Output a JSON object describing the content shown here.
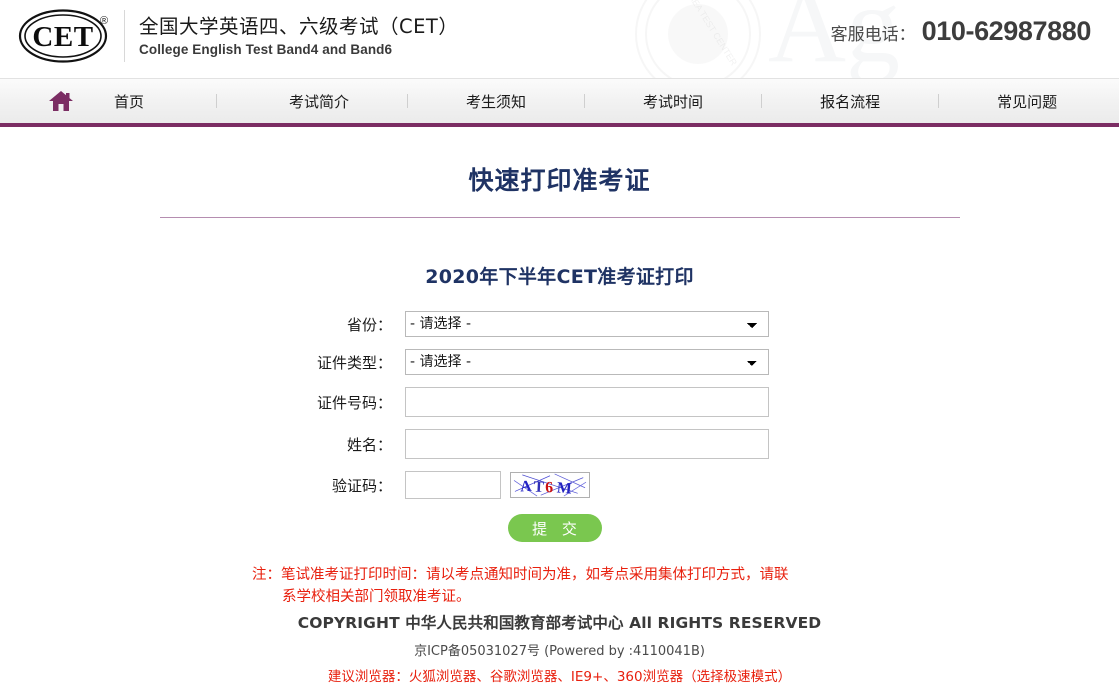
{
  "header": {
    "logo_alt": "CET",
    "logo_mark_text": "CET",
    "logo_registered": "®",
    "title_cn": "全国大学英语四、六级考试（CET）",
    "title_en": "College English Test Band4 and Band6",
    "hotline_label": "客服电话：",
    "hotline_number": "010-62987880"
  },
  "nav": {
    "home_icon": "home-icon",
    "items": [
      {
        "label": "首页"
      },
      {
        "label": "考试简介"
      },
      {
        "label": "考生须知"
      },
      {
        "label": "考试时间"
      },
      {
        "label": "报名流程"
      },
      {
        "label": "常见问题"
      }
    ]
  },
  "main": {
    "page_title": "快速打印准考证",
    "sub_title": "2020年下半年CET准考证打印"
  },
  "form": {
    "province": {
      "label": "省份：",
      "value": "- 请选择 -",
      "options": [
        "- 请选择 -"
      ]
    },
    "id_type": {
      "label": "证件类型：",
      "value": "- 请选择 -",
      "options": [
        "- 请选择 -"
      ]
    },
    "id_number": {
      "label": "证件号码：",
      "value": "",
      "placeholder": ""
    },
    "name": {
      "label": "姓名：",
      "value": "",
      "placeholder": ""
    },
    "captcha": {
      "label": "验证码：",
      "value": "",
      "placeholder": "",
      "image_text": "AT6M",
      "image_alt": "captcha-image"
    },
    "submit_label": "提 交"
  },
  "note": {
    "line1": "注：笔试准考证打印时间：请以考点通知时间为准，如考点采用集体打印方式，请联",
    "line2": "系学校相关部门领取准考证。"
  },
  "footer": {
    "copyright": "COPYRIGHT 中华人民共和国教育部考试中心 All RIGHTS RESERVED",
    "icp": "京ICP备05031027号 (Powered by :4110041B)",
    "browser_note": "建议浏览器：火狐浏览器、谷歌浏览器、IE9+、360浏览器（选择极速模式）"
  },
  "colors": {
    "brand_purple": "#7b2d63",
    "title_navy": "#1f3364",
    "note_red": "#e8200e",
    "submit_green": "#7ac74f",
    "divider_purple": "#b58db0"
  }
}
